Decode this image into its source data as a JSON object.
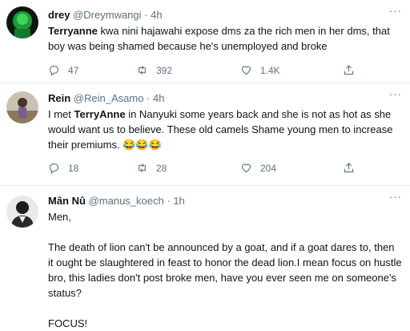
{
  "tweets": [
    {
      "display_name": "drey",
      "handle": "@Dreymwangi",
      "separator": "·",
      "time": "4h",
      "text_bold": "Terryanne",
      "text_rest": " kwa nini hajawahi expose dms za the rich men in her dms, that boy was being shamed because he's unemployed and broke",
      "replies": "47",
      "retweets": "392",
      "likes": "1.4K"
    },
    {
      "display_name": "Rein",
      "handle": "@Rein_Asamo",
      "separator": "·",
      "time": "4h",
      "text_pre": "I met ",
      "text_bold": "TerryAnne",
      "text_rest": " in Nanyuki some years back and she is not as hot as she would want us to believe. These old camels Shame young men to increase their premiums. ",
      "emoji": "😂😂😂",
      "replies": "18",
      "retweets": "28",
      "likes": "204"
    },
    {
      "display_name": "Mân Nû",
      "handle": "@manus_koech",
      "separator": "·",
      "time": "1h",
      "line1": "Men,",
      "line2": "The death of lion can't be announced by a goat, and if a goat dares to, then it ought be slaughtered in feast to honor the dead lion.I mean focus on hustle bro, this ladies don't post broke men, have you ever seen me on someone's status?",
      "line3": "FOCUS!"
    }
  ],
  "more_label": "···",
  "icons": {
    "reply": "reply-icon",
    "retweet": "retweet-icon",
    "like": "heart-icon",
    "share": "share-icon"
  },
  "colors": {
    "muted": "#5b7083",
    "divider": "#e6ecf0"
  }
}
